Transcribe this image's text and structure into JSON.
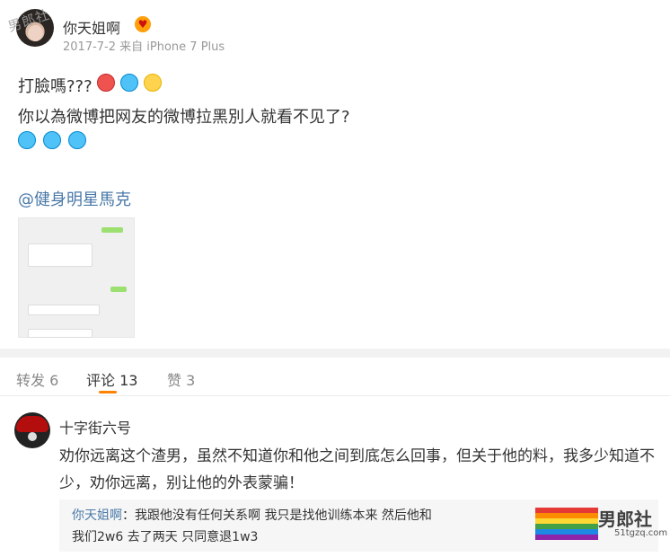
{
  "post": {
    "watermark_top": "男郎社",
    "username": "你天姐啊",
    "meta": "2017-7-2 来自 iPhone 7 Plus",
    "text_line_1": "打臉嗎???",
    "text_line_2": "你以為微博把网友的微博拉黑別人就看不见了?",
    "mention": "@健身明星馬克"
  },
  "tabs": {
    "reposts": "转发 6",
    "comments": "评论 13",
    "likes": "赞 3"
  },
  "comment": {
    "username": "十字街六号",
    "text": "劝你远离这个渣男，虽然不知道你和他之间到底怎么回事，但关于他的料，我多少知道不少，劝你远离，别让他的外表蒙骗！",
    "reply_name": "你天姐啊",
    "reply_line_1": "：我跟他没有任何关系啊 我只是找他训练本来 然后他和",
    "reply_line_2": "我们2w6 去了两天 只同意退1w3"
  },
  "watermark_bottom": {
    "brand": "男郎社",
    "site": "51tgzq.com"
  },
  "colors": {
    "accent": "#ff8200",
    "link": "#4a79a8"
  }
}
